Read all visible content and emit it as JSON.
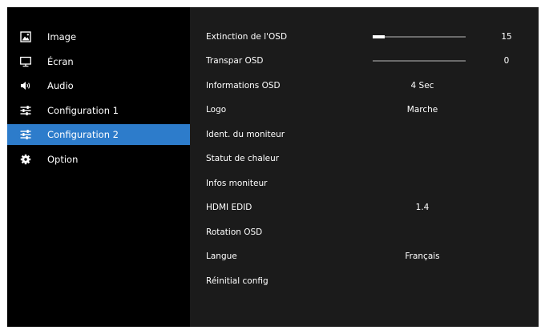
{
  "sidebar": {
    "items": [
      {
        "label": "Image",
        "icon": "image-icon"
      },
      {
        "label": "Écran",
        "icon": "monitor-icon"
      },
      {
        "label": "Audio",
        "icon": "speaker-icon"
      },
      {
        "label": "Configuration 1",
        "icon": "sliders-icon"
      },
      {
        "label": "Configuration 2",
        "icon": "sliders-icon",
        "selected": true
      },
      {
        "label": "Option",
        "icon": "gear-icon"
      }
    ]
  },
  "main": {
    "rows": [
      {
        "label": "Extinction de l'OSD",
        "slider": 15,
        "slider_max": 120,
        "display": "15"
      },
      {
        "label": "Transpar OSD",
        "slider": 0,
        "slider_max": 10,
        "display": "0"
      },
      {
        "label": "Informations OSD",
        "value": "4 Sec"
      },
      {
        "label": "Logo",
        "value": "Marche"
      },
      {
        "label": "Ident. du moniteur",
        "value": ""
      },
      {
        "label": "Statut de chaleur",
        "value": ""
      },
      {
        "label": "Infos moniteur",
        "value": ""
      },
      {
        "label": "HDMI EDID",
        "value": "1.4"
      },
      {
        "label": "Rotation OSD",
        "value": ""
      },
      {
        "label": "Langue",
        "value": "Français"
      },
      {
        "label": "Réinitial config",
        "value": ""
      }
    ]
  },
  "colors": {
    "selected": "#2d7ccb",
    "panel": "#1b1b1b",
    "background": "#000000"
  }
}
